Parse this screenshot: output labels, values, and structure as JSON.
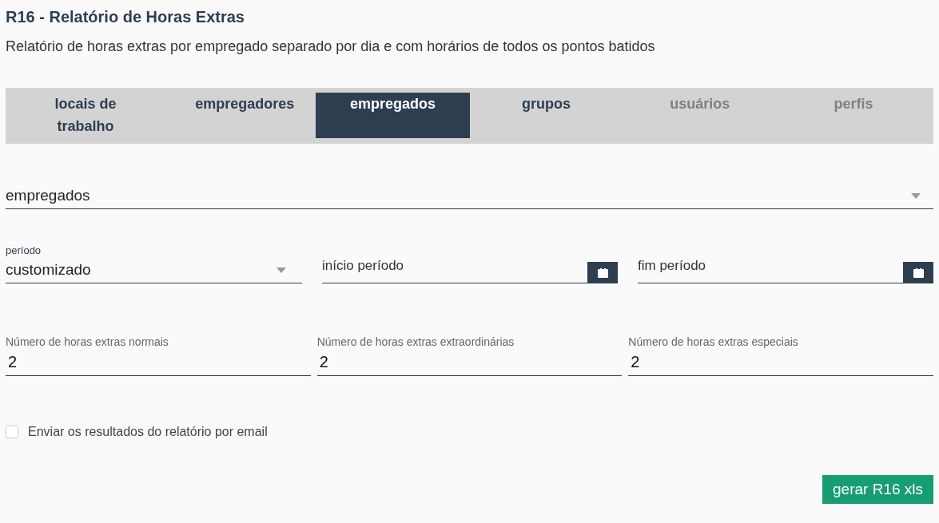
{
  "title": "R16 - Relatório de Horas Extras",
  "subtitle": "Relatório de horas extras por empregado separado por dia e com horários de todos os pontos batidos",
  "tabs": [
    {
      "label": "locais de trabalho",
      "selected": false,
      "disabled": false
    },
    {
      "label": "empregadores",
      "selected": false,
      "disabled": false
    },
    {
      "label": "empregados",
      "selected": true,
      "disabled": false
    },
    {
      "label": "grupos",
      "selected": false,
      "disabled": false
    },
    {
      "label": "usuários",
      "selected": false,
      "disabled": true
    },
    {
      "label": "perfis",
      "selected": false,
      "disabled": true
    }
  ],
  "employees_select": {
    "value": "empregados"
  },
  "period_select": {
    "label": "período",
    "value": "customizado"
  },
  "date_fields": [
    {
      "placeholder": "início período"
    },
    {
      "placeholder": "fim período"
    }
  ],
  "number_fields": [
    {
      "label": "Número de horas extras normais",
      "value": "2"
    },
    {
      "label": "Número de horas extras extraordinárias",
      "value": "2"
    },
    {
      "label": "Número de horas extras especiais",
      "value": "2"
    }
  ],
  "email_checkbox": {
    "label": "Enviar os resultados do relatório por email",
    "checked": false
  },
  "button": "gerar R16 xls"
}
